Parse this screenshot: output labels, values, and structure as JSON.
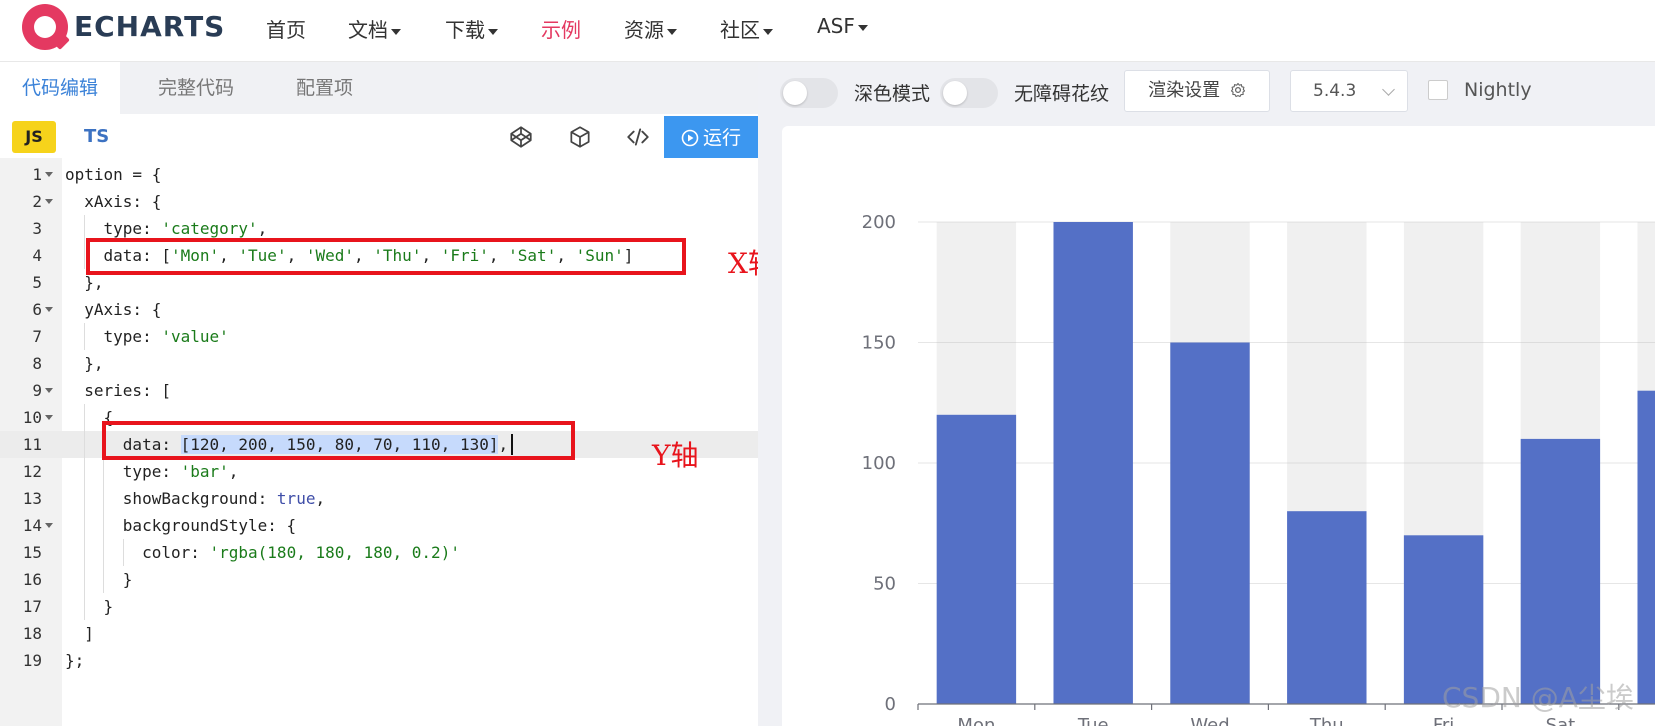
{
  "nav": {
    "logo_text": "ECHARTS",
    "items": [
      {
        "label": "首页",
        "dropdown": false,
        "active": false
      },
      {
        "label": "文档",
        "dropdown": true,
        "active": false
      },
      {
        "label": "下载",
        "dropdown": true,
        "active": false
      },
      {
        "label": "示例",
        "dropdown": false,
        "active": true
      },
      {
        "label": "资源",
        "dropdown": true,
        "active": false
      },
      {
        "label": "社区",
        "dropdown": true,
        "active": false
      },
      {
        "label": "ASF",
        "dropdown": true,
        "active": false
      }
    ]
  },
  "editor": {
    "tabs": [
      {
        "label": "代码编辑",
        "active": true
      },
      {
        "label": "完整代码",
        "active": false
      },
      {
        "label": "配置项",
        "active": false
      }
    ],
    "lang_js": "JS",
    "lang_ts": "TS",
    "toolbar_icons": [
      "codepen-icon",
      "codesandbox-icon",
      "code-icon"
    ],
    "run_label": "运行",
    "current_line": 11,
    "code_lines": [
      "option = {",
      "  xAxis: {",
      "    type: 'category',",
      "    data: ['Mon', 'Tue', 'Wed', 'Thu', 'Fri', 'Sat', 'Sun']",
      "  },",
      "  yAxis: {",
      "    type: 'value'",
      "  },",
      "  series: [",
      "    {",
      "      data: [120, 200, 150, 80, 70, 110, 130],",
      "      type: 'bar',",
      "      showBackground: true,",
      "      backgroundStyle: {",
      "        color: 'rgba(180, 180, 180, 0.2)'",
      "      }",
      "    }",
      "  ]",
      "};"
    ]
  },
  "annotations": {
    "x_axis": "X轴",
    "y_axis": "Y轴"
  },
  "preview": {
    "dark_mode_label": "深色模式",
    "aria_label": "无障碍花纹",
    "render_settings_label": "渲染设置",
    "version": "5.4.3",
    "nightly_label": "Nightly"
  },
  "chart_data": {
    "type": "bar",
    "categories": [
      "Mon",
      "Tue",
      "Wed",
      "Thu",
      "Fri",
      "Sat",
      "Sun"
    ],
    "values": [
      120,
      200,
      150,
      80,
      70,
      110,
      130
    ],
    "ylim": [
      0,
      200
    ],
    "yticks": [
      0,
      50,
      100,
      150,
      200
    ],
    "bar_color": "#5470c6",
    "background_color": "rgba(180, 180, 180, 0.2)",
    "grid": true
  },
  "watermark": "CSDN @A尘埃",
  "colors": {
    "accent": "#e43961",
    "run_button": "#3c97f0",
    "annotation": "#e8141c"
  }
}
